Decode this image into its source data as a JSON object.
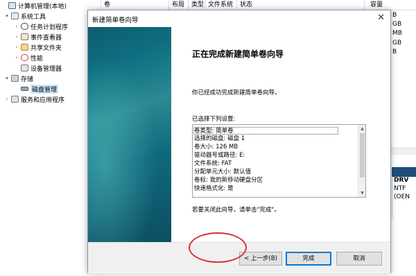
{
  "tree": {
    "items": [
      {
        "label": "计算机管理(本地)",
        "expander": "",
        "icon": "computer-icon"
      },
      {
        "label": "系统工具",
        "expander": "▾",
        "icon": "tools-icon"
      },
      {
        "label": "任务计划程序",
        "expander": "›",
        "icon": "clock-icon"
      },
      {
        "label": "事件查看器",
        "expander": "›",
        "icon": "event-viewer-icon"
      },
      {
        "label": "共享文件夹",
        "expander": "›",
        "icon": "shared-folder-icon"
      },
      {
        "label": "性能",
        "expander": "›",
        "icon": "performance-icon"
      },
      {
        "label": "设备管理器",
        "expander": "",
        "icon": "device-manager-icon"
      },
      {
        "label": "存储",
        "expander": "▾",
        "icon": "storage-icon"
      },
      {
        "label": "磁盘管理",
        "expander": "",
        "icon": "disk-icon"
      },
      {
        "label": "服务和应用程序",
        "expander": "›",
        "icon": "services-icon"
      }
    ]
  },
  "list_header": {
    "columns": [
      "卷",
      "布局",
      "类型",
      "文件系统",
      "状态",
      "容量"
    ]
  },
  "background_fragments": {
    "capacity_suffixes": [
      "B",
      "GB",
      "MB",
      "GB",
      "B"
    ],
    "disk_panel": [
      "DRV",
      "NTF",
      "(OEN"
    ]
  },
  "wizard": {
    "title": "新建简单卷向导",
    "close_glyph": "✕",
    "heading": "正在完成新建简单卷向导",
    "intro": "你已经成功完成新建简单卷向导。",
    "settings_label": "已选择下列设置:",
    "settings": [
      "卷类型: 简单卷",
      "选择的磁盘: 磁盘 1",
      "卷大小: 126 MB",
      "驱动器号或路径: E:",
      "文件系统: FAT",
      "分配单元大小: 默认值",
      "卷标: 我的新移动硬盘分区",
      "快速格式化: 是"
    ],
    "close_hint": "若要关闭此向导，请单击\"完成\"。",
    "buttons": {
      "back": "< 上一步(B)",
      "finish": "完成",
      "cancel": "取消"
    }
  },
  "colors": {
    "banner_teal": "#0f6e80",
    "highlight_ring": "#d9323b",
    "default_button_border": "#0078d7",
    "selection": "#cce8ff"
  }
}
